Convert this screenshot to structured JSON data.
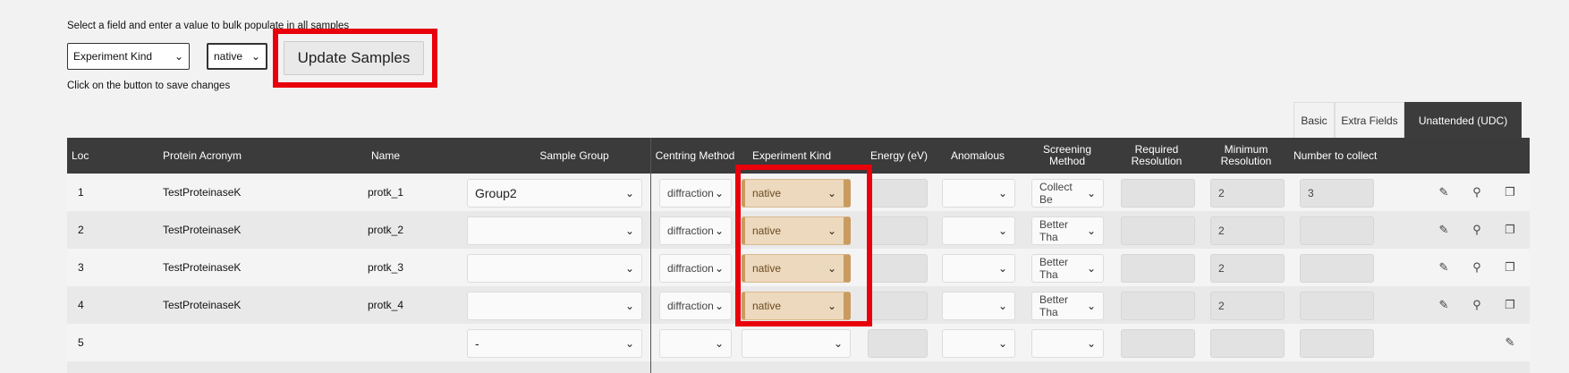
{
  "bulk": {
    "instruction": "Select a field and enter a value to bulk populate in all samples",
    "field_select": "Experiment Kind",
    "value_select": "native",
    "update_button": "Update Samples",
    "save_hint": "Click on the button to save changes"
  },
  "tabs": [
    {
      "label": "Basic",
      "active": false
    },
    {
      "label": "Extra Fields",
      "active": false
    },
    {
      "label": "Unattended (UDC)",
      "active": true
    }
  ],
  "columns": {
    "loc": "Loc",
    "protein": "Protein Acronym",
    "name": "Name",
    "group": "Sample Group",
    "centring": "Centring Method",
    "kind": "Experiment Kind",
    "energy": "Energy (eV)",
    "anomalous": "Anomalous",
    "screening": "Screening Method",
    "required": "Required Resolution",
    "minimum": "Minimum Resolution",
    "number": "Number to collect"
  },
  "rows": [
    {
      "loc": "1",
      "protein": "TestProteinaseK",
      "name": "protk_1",
      "group": "Group2",
      "centring": "diffraction",
      "kind": "native",
      "energy": "",
      "anomalous": "",
      "screening": "Collect Be",
      "required": "",
      "minimum": "2",
      "number": "3"
    },
    {
      "loc": "2",
      "protein": "TestProteinaseK",
      "name": "protk_2",
      "group": "",
      "centring": "diffraction",
      "kind": "native",
      "energy": "",
      "anomalous": "",
      "screening": "Better Tha",
      "required": "",
      "minimum": "2",
      "number": ""
    },
    {
      "loc": "3",
      "protein": "TestProteinaseK",
      "name": "protk_3",
      "group": "",
      "centring": "diffraction",
      "kind": "native",
      "energy": "",
      "anomalous": "",
      "screening": "Better Tha",
      "required": "",
      "minimum": "2",
      "number": ""
    },
    {
      "loc": "4",
      "protein": "TestProteinaseK",
      "name": "protk_4",
      "group": "",
      "centring": "diffraction",
      "kind": "native",
      "energy": "",
      "anomalous": "",
      "screening": "Better Tha",
      "required": "",
      "minimum": "2",
      "number": ""
    },
    {
      "loc": "5",
      "protein": "",
      "name": "",
      "group": "-",
      "centring": "",
      "kind": "",
      "energy": "",
      "anomalous": "",
      "screening": "",
      "required": "",
      "minimum": "",
      "number": ""
    }
  ],
  "icons": {
    "chevron": "⌄",
    "edit": "✎",
    "search": "⚲",
    "clone": "❐"
  },
  "colors": {
    "highlight": "#e8000b",
    "header_bg": "#3b3b3b",
    "native_bg": "#edd9bd",
    "native_accent": "#c99b61"
  }
}
